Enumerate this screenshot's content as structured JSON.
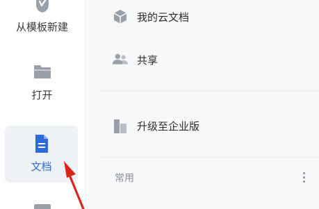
{
  "rail": {
    "template_label": "从模板新建",
    "open_label": "打开",
    "docs_label": "文档"
  },
  "panel": {
    "my_cloud_docs": "我的云文档",
    "shared": "共享",
    "upgrade": "升级至企业版",
    "frequent_section": "常用"
  },
  "icons": {
    "template": "template-icon",
    "open": "folder-icon",
    "docs": "document-icon",
    "cloud": "cube-icon",
    "shared": "people-icon",
    "upgrade": "building-icon",
    "more": "more-vertical-icon"
  },
  "colors": {
    "accent": "#2f6bd8",
    "annotation_arrow": "#d9261c",
    "active_bg": "#eef1f5",
    "panel_bg": "#f7f8fa"
  }
}
